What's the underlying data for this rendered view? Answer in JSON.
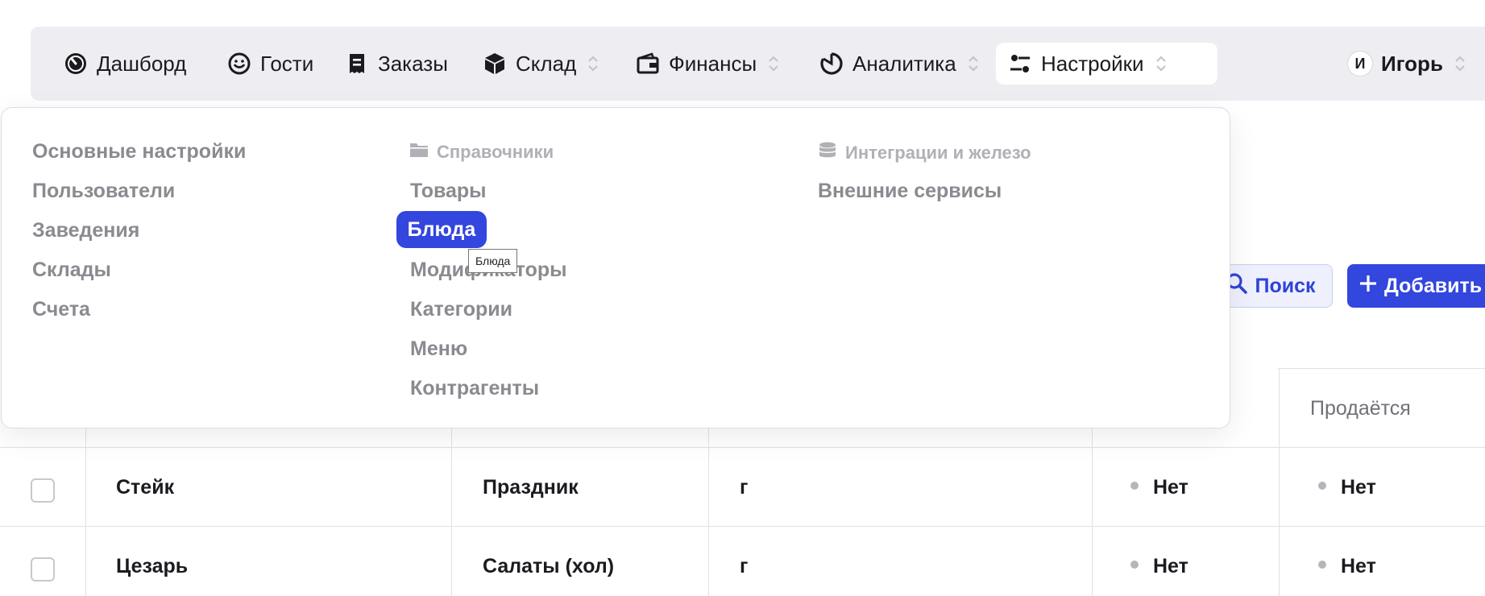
{
  "nav": {
    "items": [
      {
        "label": "Дашборд",
        "icon": "dashboard-gauge-icon"
      },
      {
        "label": "Гости",
        "icon": "smiley-icon"
      },
      {
        "label": "Заказы",
        "icon": "receipt-icon"
      },
      {
        "label": "Склад",
        "icon": "box-icon"
      },
      {
        "label": "Финансы",
        "icon": "wallet-icon"
      },
      {
        "label": "Аналитика",
        "icon": "pie-chart-icon"
      },
      {
        "label": "Настройки",
        "icon": "sliders-icon"
      }
    ],
    "user": {
      "initial": "И",
      "name": "Игорь"
    }
  },
  "toolbar": {
    "search_label": "Поиск",
    "add_label": "Добавить"
  },
  "settings_menu": {
    "col1": {
      "items": [
        "Основные настройки",
        "Пользователи",
        "Заведения",
        "Склады",
        "Счета"
      ]
    },
    "col2": {
      "heading": "Справочники",
      "items": [
        "Товары",
        "Блюда",
        "Модификаторы",
        "Категории",
        "Меню",
        "Контрагенты"
      ],
      "active": "Блюда"
    },
    "col3": {
      "heading": "Интеграции и железо",
      "items": [
        "Внешние сервисы"
      ]
    },
    "tooltip": "Блюда"
  },
  "table": {
    "visible_header": "Продаётся",
    "rows": [
      {
        "name": "Стейк",
        "category": "Праздник",
        "unit": "г",
        "col5": "Нет",
        "sold": "Нет"
      },
      {
        "name": "Цезарь",
        "category": "Салаты (хол)",
        "unit": "г",
        "col5": "Нет",
        "sold": "Нет"
      }
    ]
  },
  "colors": {
    "accent": "#3346de",
    "nav_bg": "#eeeef2",
    "muted_text": "#8a8a90"
  }
}
